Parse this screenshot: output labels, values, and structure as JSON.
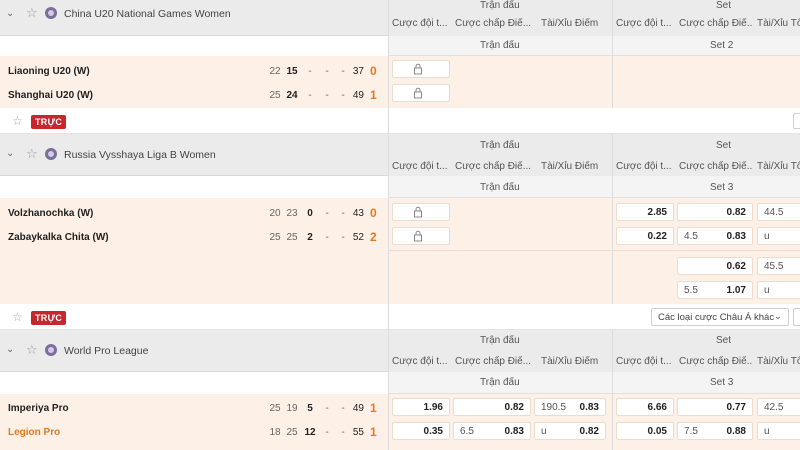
{
  "column_headers": {
    "tran_dau": "Trận đấu",
    "set": "Set",
    "cuoc_doi": "Cược đội t...",
    "cuoc_chap": "Cược chấp Điể...",
    "tai_xiu": "Tài/Xỉu Điểm",
    "tai_xiu_short": "Tài/Xỉu Tô"
  },
  "live_label": "TRỰC",
  "bet_type_select": "Các loại cược Châu Á khác",
  "leagues": [
    {
      "name": "China U20 National Games Women",
      "sub_set": "Set 2",
      "teams": [
        {
          "name": "Liaoning U20 (W)",
          "s1": "22",
          "s2": "15",
          "s3": "-",
          "s4": "-",
          "s5": "-",
          "total": "37",
          "sets": "0"
        },
        {
          "name": "Shanghai U20 (W)",
          "s1": "25",
          "s2": "24",
          "s3": "-",
          "s4": "-",
          "s5": "-",
          "total": "49",
          "sets": "1"
        }
      ]
    },
    {
      "name": "Russia Vysshaya Liga B Women",
      "sub_set": "Set 3",
      "teams": [
        {
          "name": "Volzhanochka (W)",
          "s1": "20",
          "s2": "23",
          "s3": "0",
          "s4": "-",
          "s5": "-",
          "total": "43",
          "sets": "0"
        },
        {
          "name": "Zabaykalka Chita (W)",
          "s1": "25",
          "s2": "25",
          "s3": "2",
          "s4": "-",
          "s5": "-",
          "total": "52",
          "sets": "2"
        }
      ],
      "set_odds": {
        "r1": {
          "ml": "2.85",
          "hcp": "",
          "hcp_val": "0.82",
          "ou": "44.5"
        },
        "r2": {
          "ml": "0.22",
          "hcp": "4.5",
          "hcp_val": "0.83",
          "ou": "u"
        },
        "r3": {
          "hcp": "",
          "hcp_val": "0.62",
          "ou": "45.5"
        },
        "r4": {
          "hcp": "5.5",
          "hcp_val": "1.07",
          "ou": "u"
        }
      }
    },
    {
      "name": "World Pro League",
      "sub_set": "Set 3",
      "teams": [
        {
          "name": "Imperiya Pro",
          "s1": "25",
          "s2": "19",
          "s3": "5",
          "s4": "-",
          "s5": "-",
          "total": "49",
          "sets": "1"
        },
        {
          "name": "Legion Pro",
          "s1": "18",
          "s2": "25",
          "s3": "12",
          "s4": "-",
          "s5": "-",
          "total": "55",
          "sets": "1"
        }
      ],
      "match_odds": {
        "r1": {
          "ml": "1.96",
          "hcp": "",
          "hcp_val": "0.82",
          "ou_line": "190.5",
          "ou_val": "0.83"
        },
        "r2": {
          "ml": "0.35",
          "hcp": "6.5",
          "hcp_val": "0.83",
          "ou_line": "u",
          "ou_val": "0.82"
        }
      },
      "set_odds": {
        "r1": {
          "ml": "6.66",
          "hcp": "",
          "hcp_val": "0.77",
          "ou": "42.5"
        },
        "r2": {
          "ml": "0.05",
          "hcp": "7.5",
          "hcp_val": "0.88",
          "ou": "u"
        }
      }
    }
  ]
}
